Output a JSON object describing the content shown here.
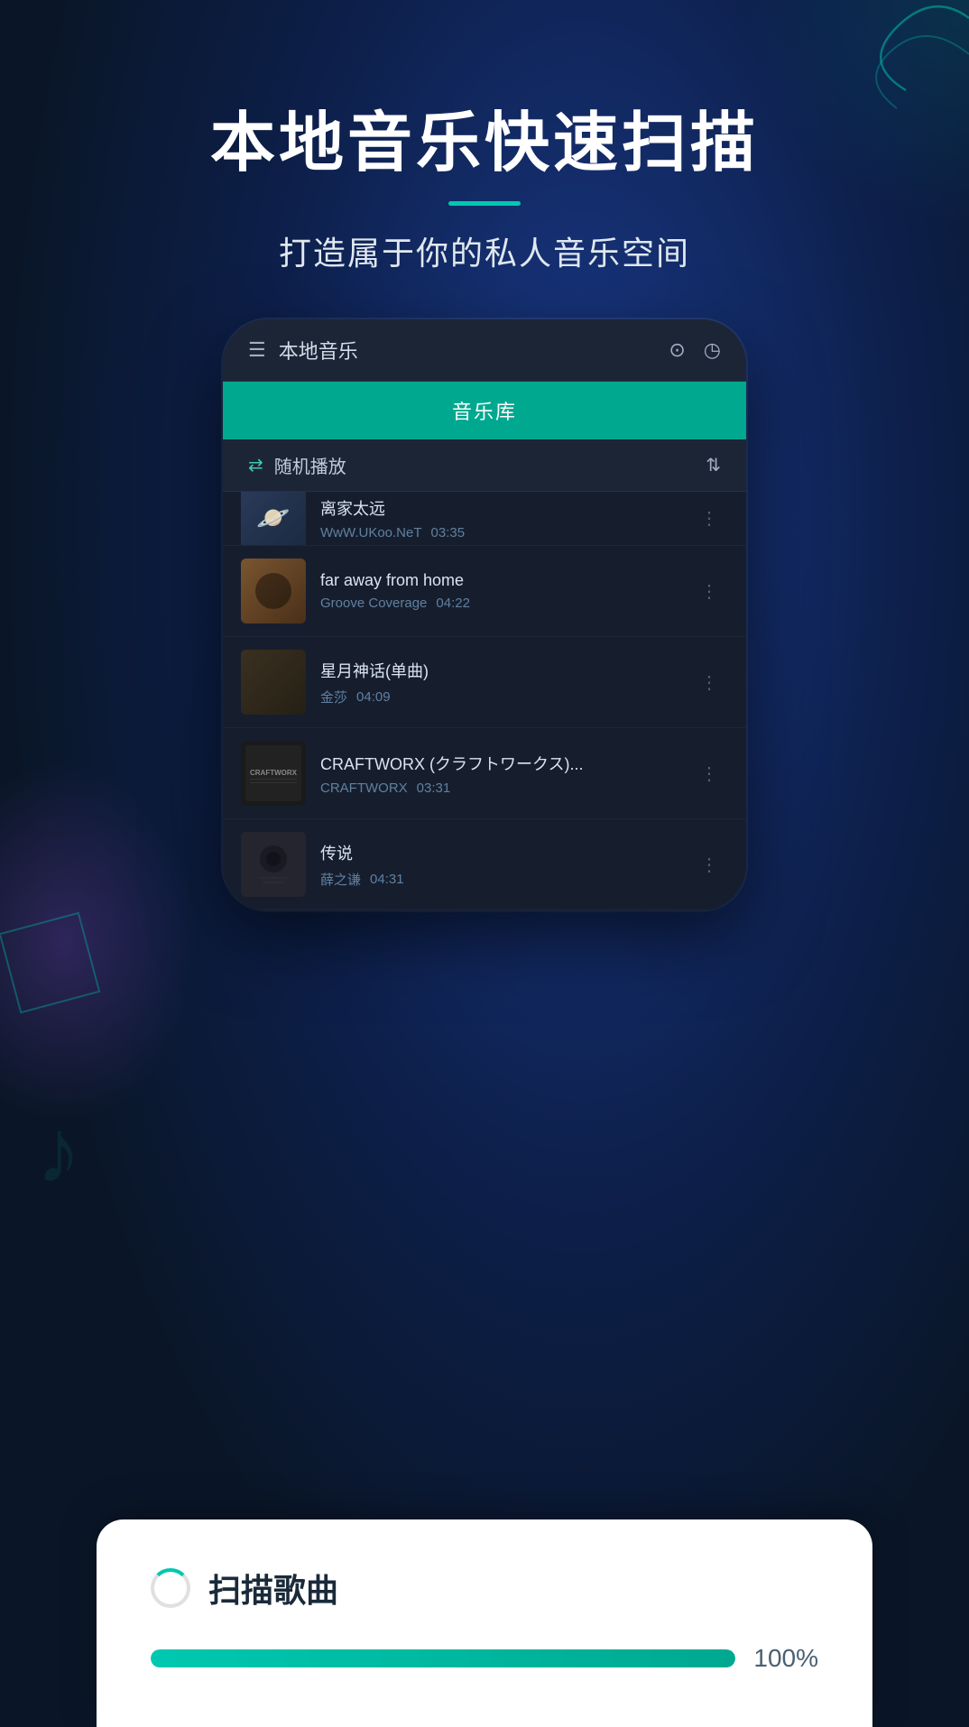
{
  "page": {
    "background": "#0a1628"
  },
  "hero": {
    "title": "本地音乐快速扫描",
    "subtitle": "打造属于你的私人音乐空间"
  },
  "phone": {
    "topbar_title": "本地音乐",
    "music_library_tab": "音乐库",
    "shuffle_text": "随机播放"
  },
  "songs": [
    {
      "title": "离家太远",
      "artist": "WwW.UKoo.NeT",
      "duration": "03:35",
      "thumb_class": "thumb-1"
    },
    {
      "title": "far away from home",
      "artist": "Groove Coverage",
      "duration": "04:22",
      "thumb_class": "thumb-2"
    },
    {
      "title": "星月神话(单曲)",
      "artist": "金莎",
      "duration": "04:09",
      "thumb_class": "thumb-3"
    },
    {
      "title": "CRAFTWORX (クラフトワークス)...",
      "artist": "CRAFTWORX",
      "duration": "03:31",
      "thumb_class": "thumb-4"
    },
    {
      "title": "传说",
      "artist": "薛之谦",
      "duration": "04:31",
      "thumb_class": "thumb-5"
    }
  ],
  "scan_card": {
    "title": "扫描歌曲",
    "progress_percent": "100%"
  }
}
